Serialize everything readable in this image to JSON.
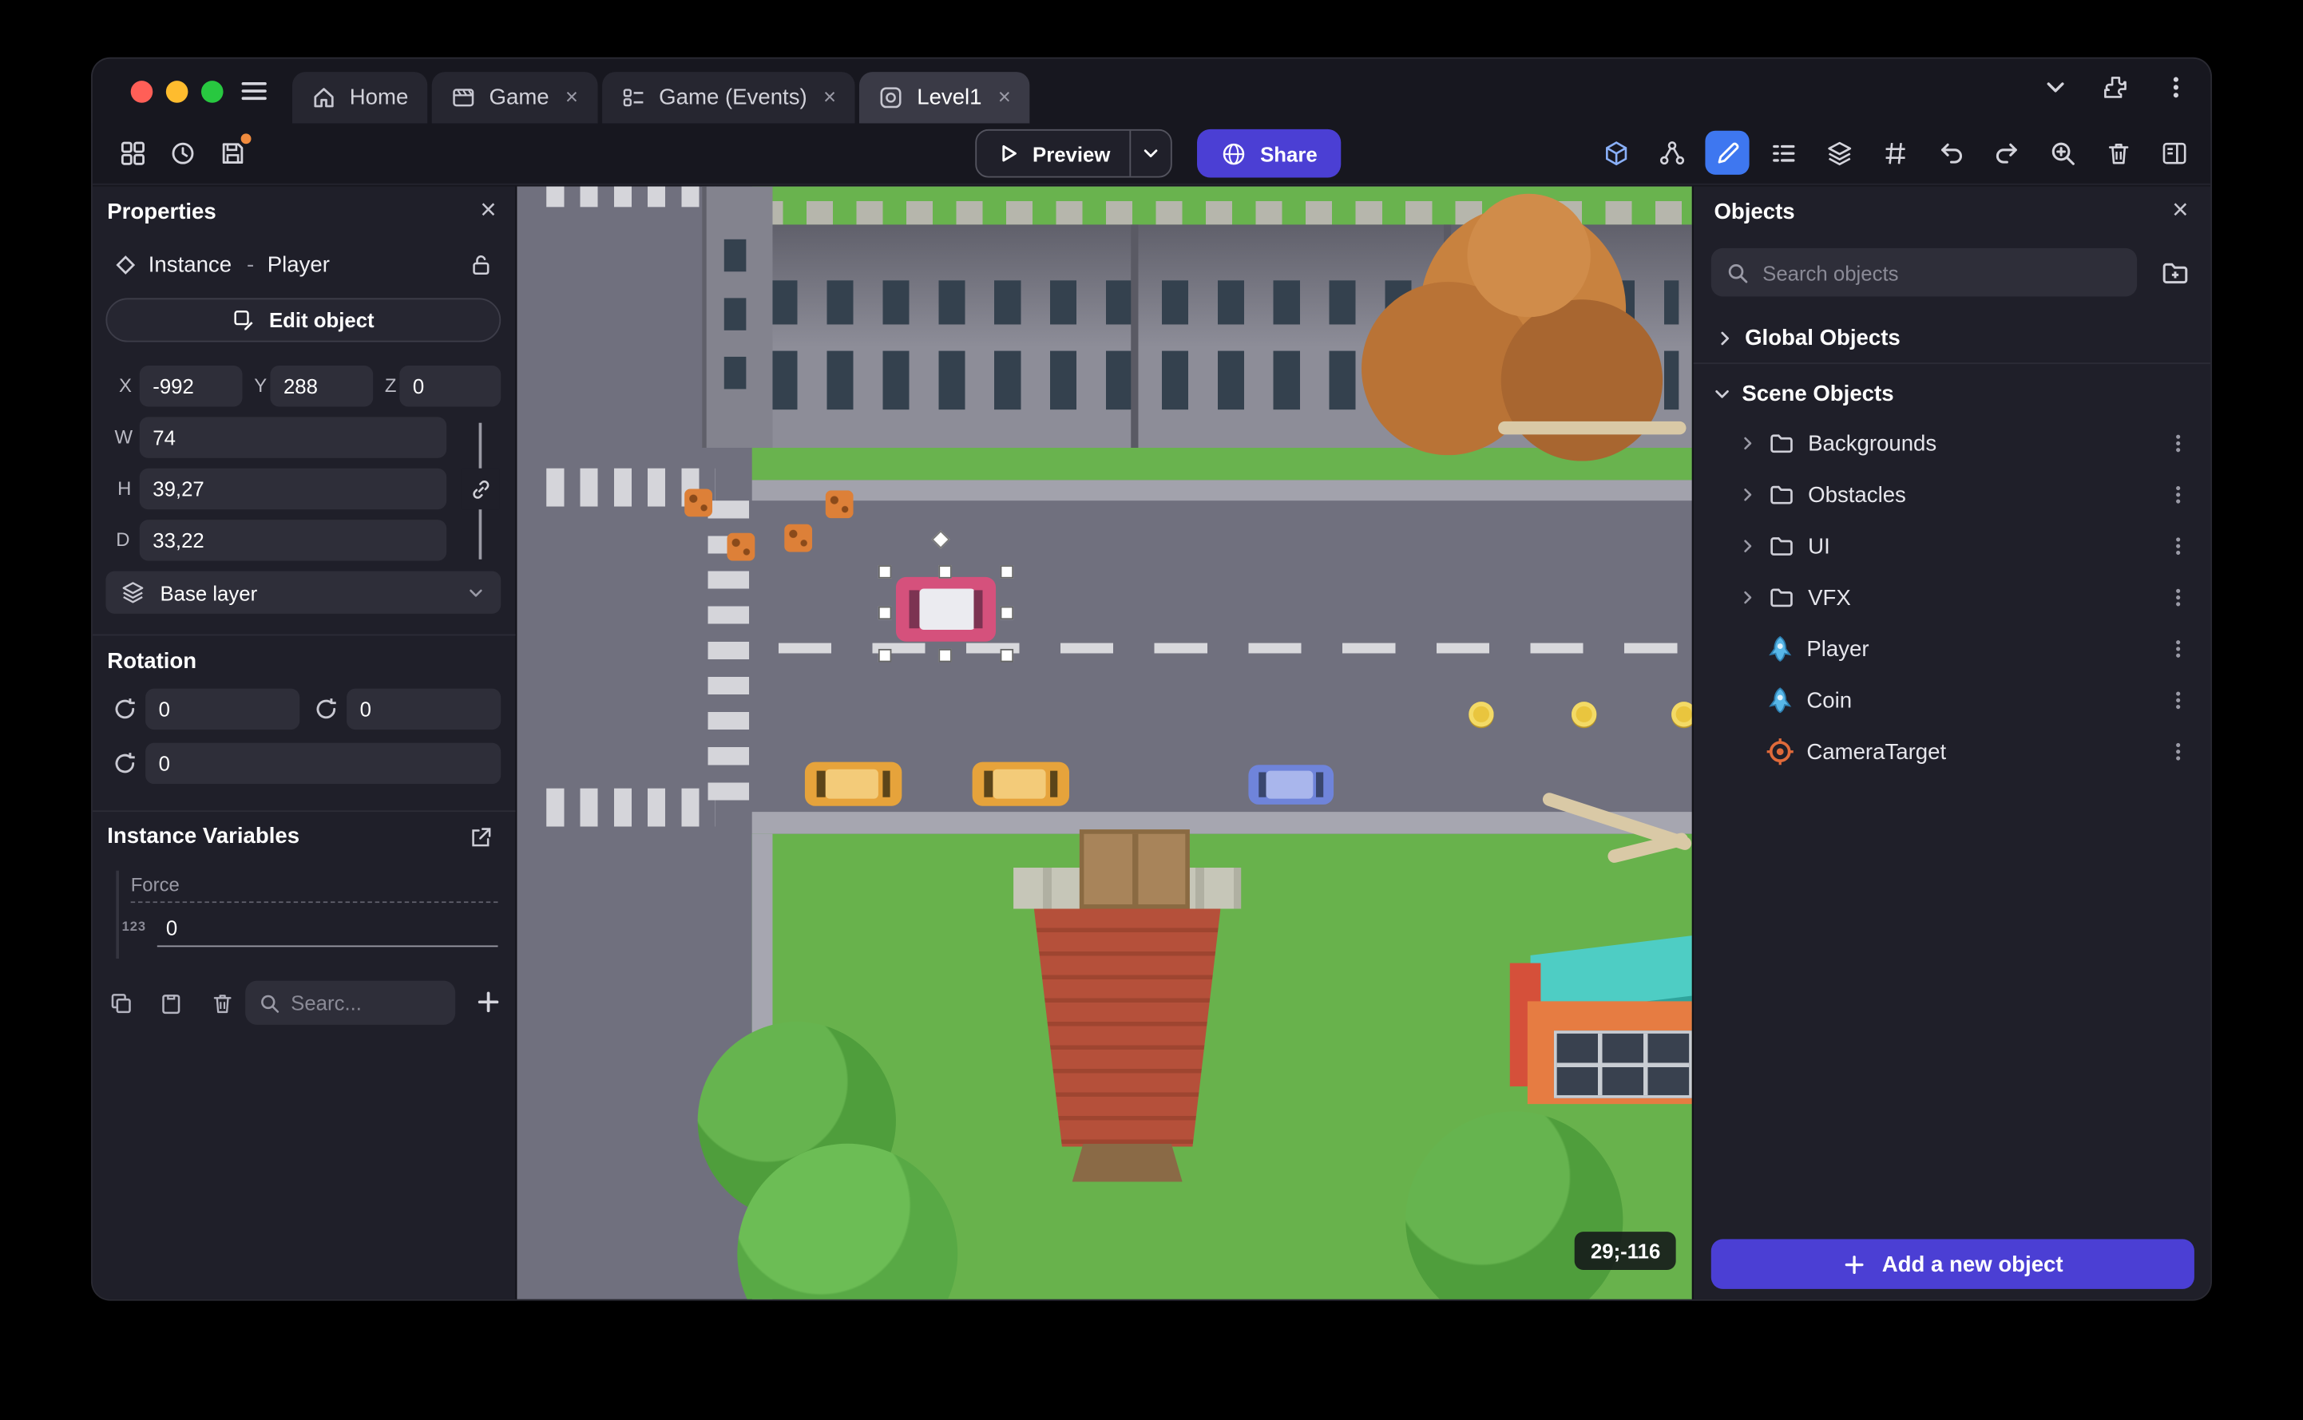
{
  "glyphs": {
    "close": "×",
    "dash": "-"
  },
  "titlebar": {
    "tabs": [
      {
        "label": "Home"
      },
      {
        "label": "Game"
      },
      {
        "label": "Game (Events)"
      },
      {
        "label": "Level1"
      }
    ]
  },
  "toolbar": {
    "preview": "Preview",
    "share": "Share"
  },
  "properties": {
    "title": "Properties",
    "instance_label": "Instance",
    "object_name": "Player",
    "edit_object": "Edit object",
    "coords": {
      "x_label": "X",
      "x": "-992",
      "y_label": "Y",
      "y": "288",
      "z_label": "Z",
      "z": "0"
    },
    "size": {
      "w_label": "W",
      "w": "74",
      "h_label": "H",
      "h": "39,27",
      "d_label": "D",
      "d": "33,22"
    },
    "layer": "Base layer",
    "rotation": {
      "title": "Rotation",
      "rx": "0",
      "ry": "0",
      "rz": "0"
    },
    "variables": {
      "title": "Instance Variables",
      "rows": [
        {
          "name": "Force",
          "type_badge": "123",
          "value": "0"
        }
      ],
      "search_placeholder": "Searc..."
    }
  },
  "canvas": {
    "badge": "29;-116"
  },
  "objects": {
    "title": "Objects",
    "search_placeholder": "Search objects",
    "global_group": "Global Objects",
    "scene_group": "Scene Objects",
    "folders": [
      "Backgrounds",
      "Obstacles",
      "UI",
      "VFX"
    ],
    "items": [
      "Player",
      "Coin",
      "CameraTarget"
    ],
    "add_button": "Add a new object"
  },
  "colors": {
    "accent": "#4b3fd4",
    "active_tool": "#3e77f0",
    "selection": "#ffffff"
  }
}
